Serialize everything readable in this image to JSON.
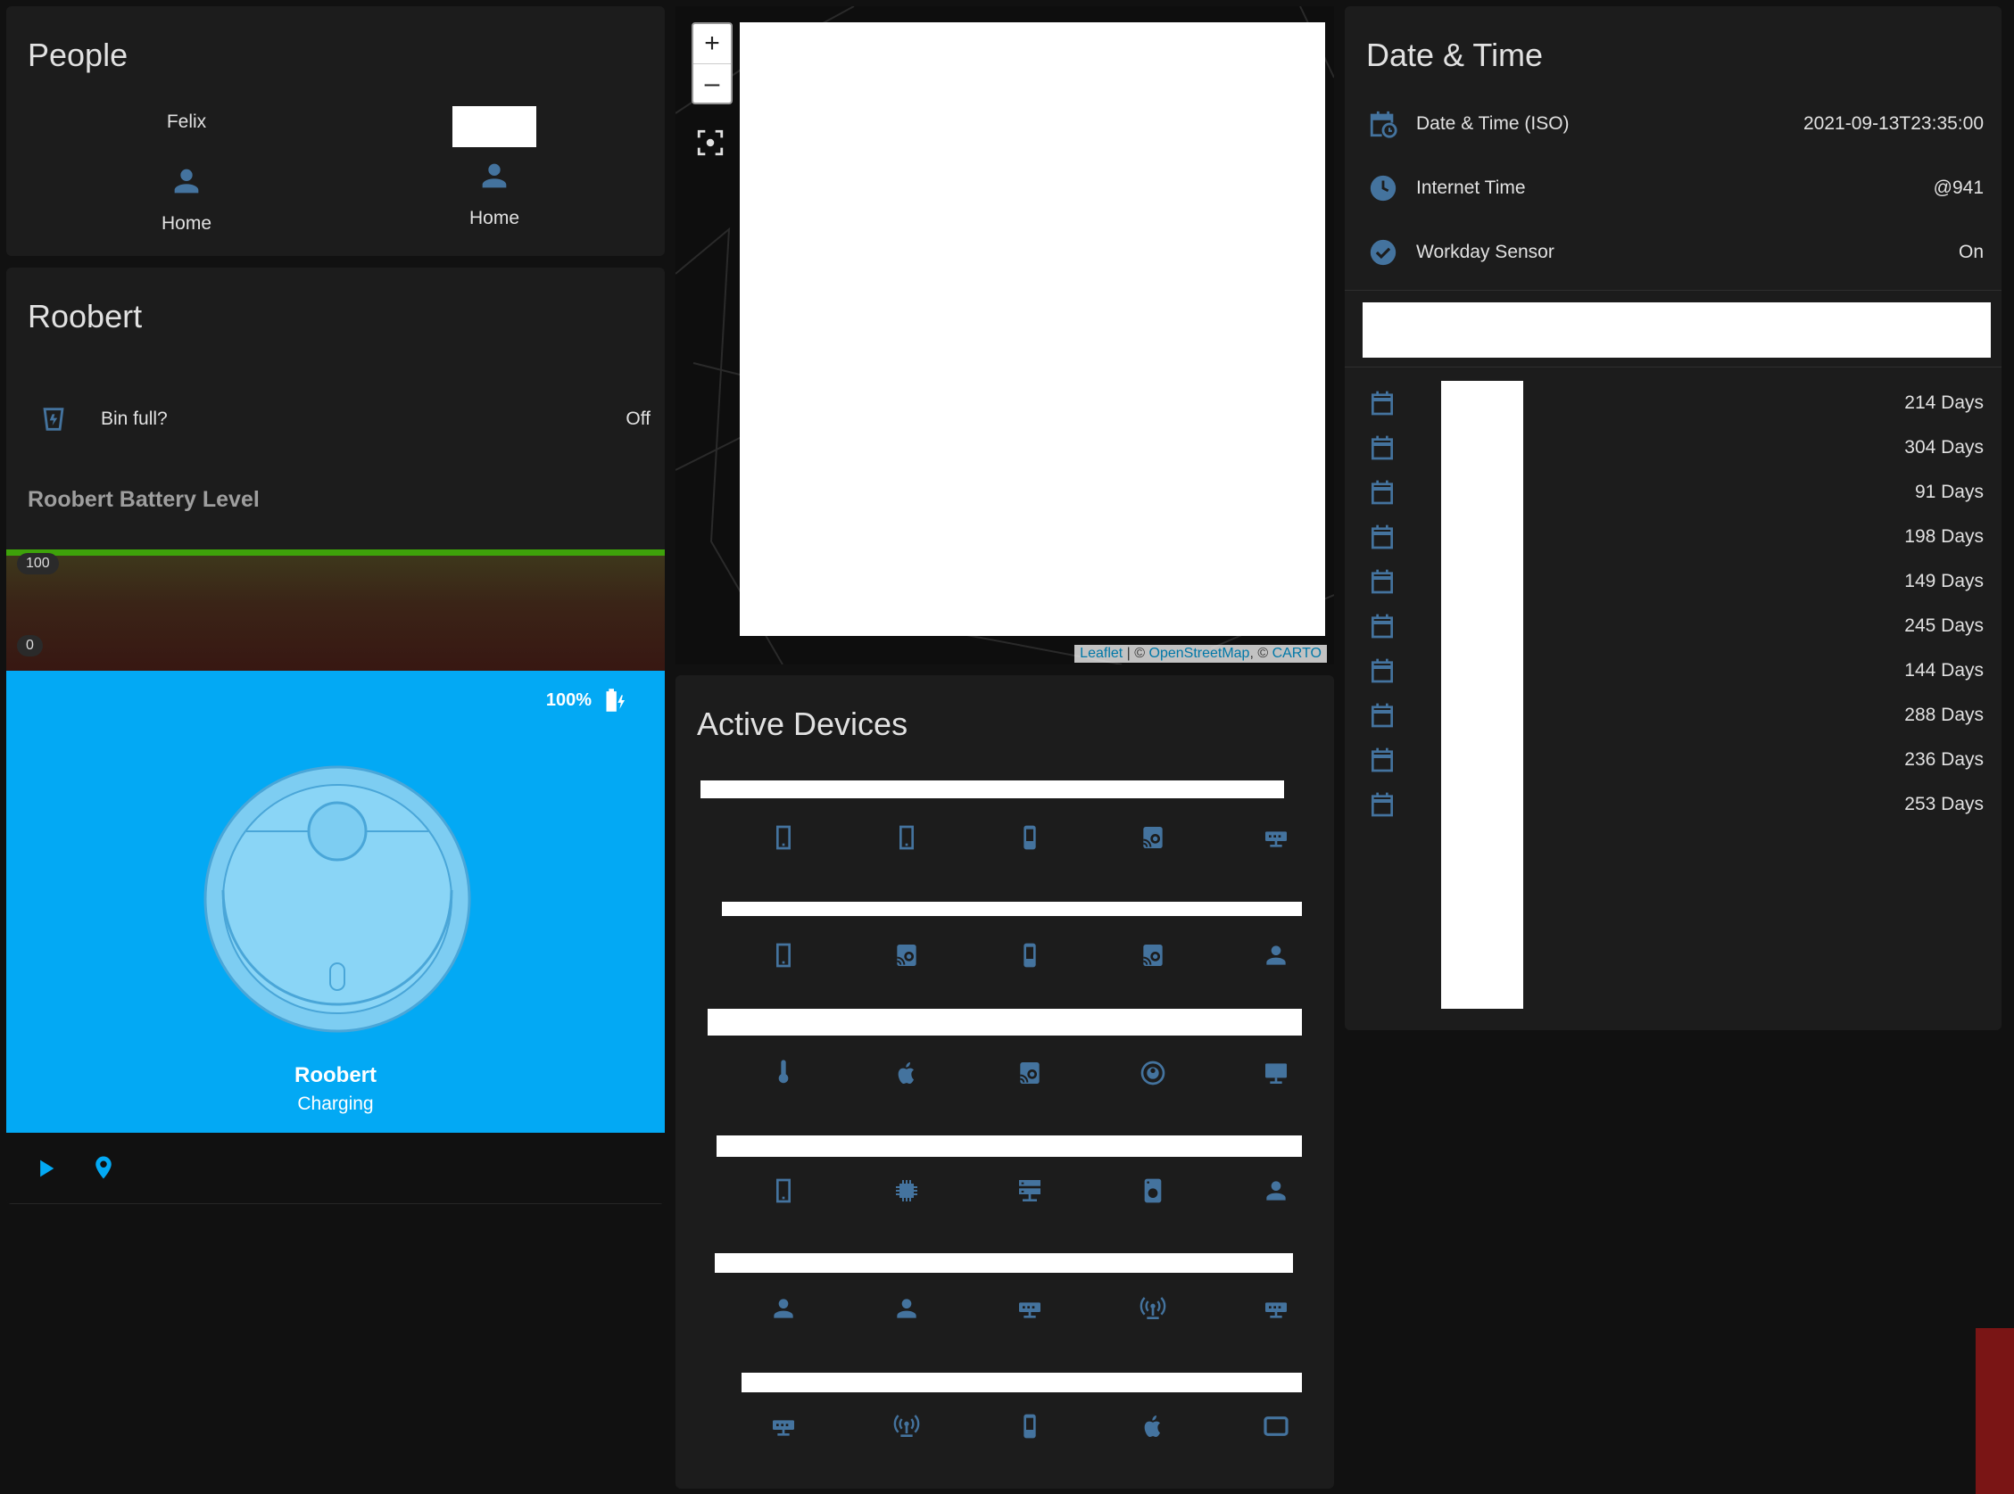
{
  "people": {
    "title": "People",
    "persons": [
      {
        "name": "Felix",
        "state": "Home"
      },
      {
        "name": "",
        "state": "Home"
      }
    ]
  },
  "roobert": {
    "title": "Roobert",
    "bin": {
      "label": "Bin full?",
      "value": "Off"
    },
    "battery_title": "Roobert Battery Level",
    "graph_max": "100",
    "graph_min": "0",
    "battery_percent": "100%",
    "vacuum_name": "Roobert",
    "vacuum_status": "Charging"
  },
  "map": {
    "attribution_leaflet": "Leaflet",
    "attribution_osm": "OpenStreetMap",
    "attribution_carto": "CARTO",
    "attribution_sep1": " | © ",
    "attribution_sep2": ", © "
  },
  "devices": {
    "title": "Active Devices",
    "rows": [
      [
        "phone-icon",
        "phone-icon",
        "cellphone-icon",
        "speaker-icon",
        "router-icon"
      ],
      [
        "phone-icon",
        "speaker-icon",
        "cellphone-icon",
        "speaker-icon",
        "person-icon"
      ],
      [
        "thermometer-icon",
        "apple-icon",
        "speaker-icon",
        "robot-vacuum-icon",
        "monitor-icon"
      ],
      [
        "phone-icon",
        "chip-icon",
        "server-icon",
        "washer-icon",
        "person-icon"
      ],
      [
        "person-icon",
        "person-icon",
        "router-icon",
        "access-point-icon",
        "router-icon"
      ],
      [
        "router-icon",
        "access-point-icon",
        "cellphone-icon",
        "apple-icon",
        "tablet-icon"
      ]
    ]
  },
  "datetime": {
    "title": "Date & Time",
    "rows": [
      {
        "label": "Date & Time (ISO)",
        "value": "2021-09-13T23:35:00",
        "icon": "calendar-clock-icon"
      },
      {
        "label": "Internet Time",
        "value": "@941",
        "icon": "clock-icon"
      },
      {
        "label": "Workday Sensor",
        "value": "On",
        "icon": "check-circle-icon"
      }
    ],
    "countdowns": [
      "214 Days",
      "304 Days",
      "91 Days",
      "198 Days",
      "149 Days",
      "245 Days",
      "144 Days",
      "288 Days",
      "236 Days",
      "253 Days"
    ]
  },
  "colors": {
    "accent": "#03a9f4",
    "icon": "#44739e",
    "card": "#1c1c1c",
    "background": "#111111"
  }
}
